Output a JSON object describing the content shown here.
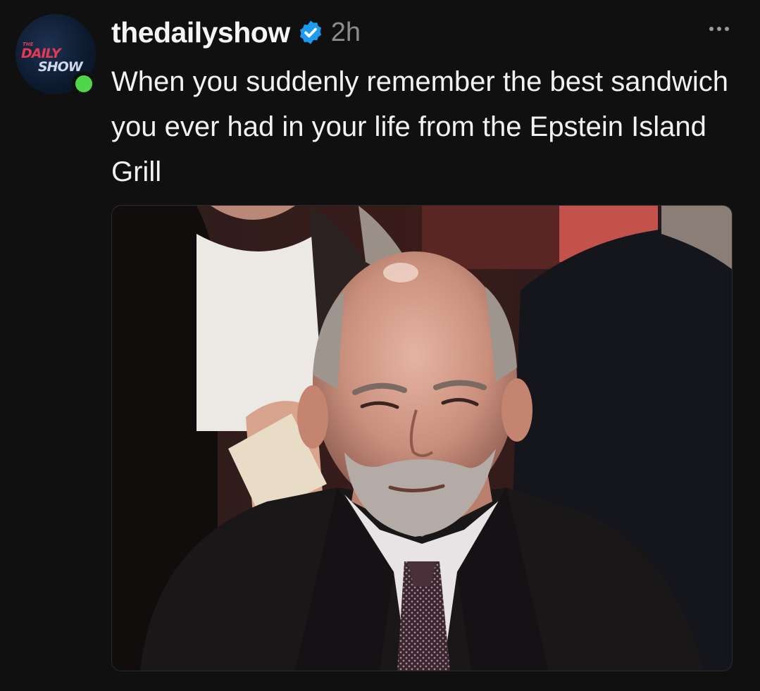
{
  "post": {
    "username": "thedailyshow",
    "verified_icon": "verified-badge-icon",
    "timestamp": "2h",
    "more_icon": "more-options-icon",
    "caption": "When you suddenly remember the best sandwich you ever had in your life from the Epstein Island Grill",
    "avatar": {
      "logo_the": "THE",
      "logo_daily": "DAILY",
      "logo_show": "SHOW",
      "online_status_color": "#4fd64a"
    },
    "media": {
      "type": "photo"
    }
  },
  "colors": {
    "background": "#101010",
    "text_primary": "#f2f2f2",
    "text_secondary": "#8c8c8c",
    "verified_blue": "#1d9bf0"
  }
}
